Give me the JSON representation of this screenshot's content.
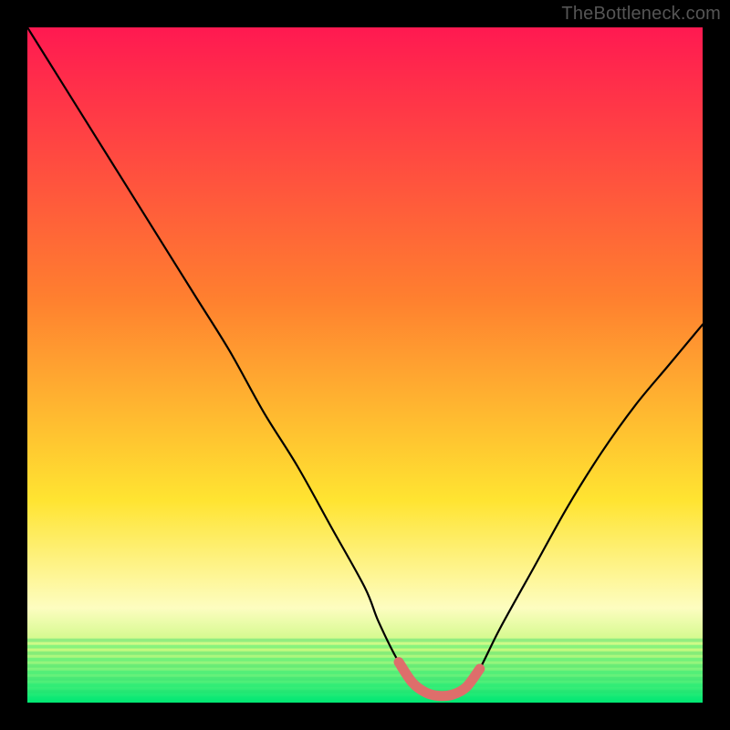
{
  "watermark": "TheBottleneck.com",
  "colors": {
    "frame": "#000000",
    "watermark": "#555555",
    "curve_main": "#000000",
    "curve_accent": "#DE6E6B",
    "gradient_top": "#FF1951",
    "gradient_mid1": "#FF7F2F",
    "gradient_mid2": "#FFE431",
    "gradient_pale": "#FDFDC0",
    "gradient_green": "#00E874"
  },
  "chart_data": {
    "type": "line",
    "title": "",
    "xlabel": "",
    "ylabel": "",
    "x_range": [
      0,
      100
    ],
    "y_range": [
      0,
      100
    ],
    "series": [
      {
        "name": "bottleneck-curve",
        "x": [
          0,
          5,
          10,
          15,
          20,
          25,
          30,
          35,
          40,
          45,
          50,
          52,
          55,
          58,
          60,
          62,
          65,
          67,
          70,
          75,
          80,
          85,
          90,
          95,
          100
        ],
        "y": [
          100,
          92,
          84,
          76,
          68,
          60,
          52,
          43,
          35,
          26,
          17,
          12,
          6,
          2,
          1,
          1,
          2,
          5,
          11,
          20,
          29,
          37,
          44,
          50,
          56
        ]
      }
    ],
    "accent_segment": {
      "name": "trough-highlight",
      "x": [
        55,
        57,
        59,
        61,
        63,
        65,
        67
      ],
      "y": [
        6,
        3,
        1.5,
        1,
        1.2,
        2.3,
        5
      ]
    },
    "gradient_stops": [
      {
        "offset": 0.0,
        "color": "#FF1951"
      },
      {
        "offset": 0.4,
        "color": "#FF7F2F"
      },
      {
        "offset": 0.7,
        "color": "#FFE431"
      },
      {
        "offset": 0.86,
        "color": "#FDFDC0"
      },
      {
        "offset": 0.92,
        "color": "#C8F97F"
      },
      {
        "offset": 1.0,
        "color": "#00E874"
      }
    ]
  }
}
